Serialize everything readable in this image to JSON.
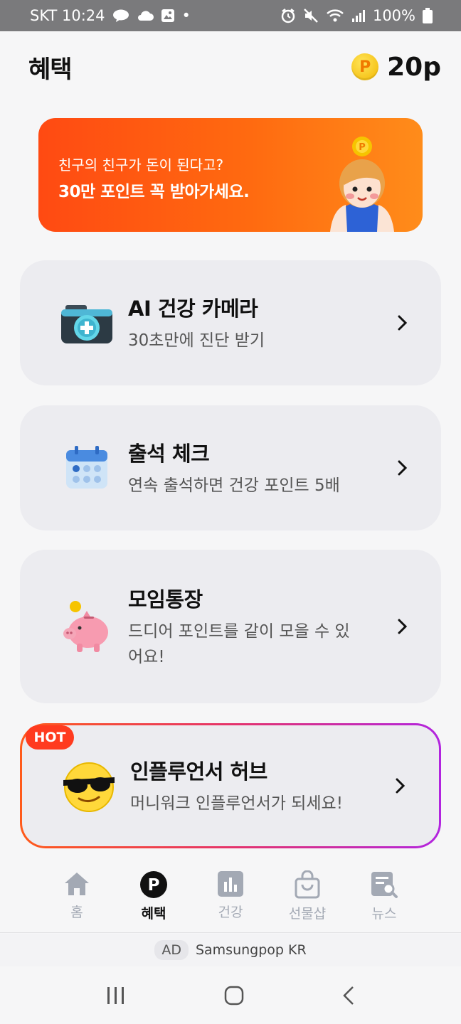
{
  "status_bar": {
    "carrier_time": "SKT 10:24",
    "dot": "•",
    "battery": "100%"
  },
  "header": {
    "title": "혜택",
    "coin_letter": "P",
    "points": "20p"
  },
  "banner": {
    "subtitle": "친구의 친구가 돈이 된다고?",
    "headline": "30만 포인트 꼭 받아가세요."
  },
  "cards": [
    {
      "title": "AI 건강 카메라",
      "desc": "30초만에 진단 받기",
      "icon": "medical-camera-icon"
    },
    {
      "title": "출석 체크",
      "desc": "연속 출석하면 건강 포인트 5배",
      "icon": "calendar-icon"
    },
    {
      "title": "모임통장",
      "desc": "드디어 포인트를 같이 모을 수 있어요!",
      "icon": "piggy-bank-icon"
    },
    {
      "title": "인플루언서 허브",
      "desc": "머니워크 인플루언서가 되세요!",
      "icon": "sunglasses-emoji-icon",
      "badge": "HOT"
    }
  ],
  "bottom_nav": [
    {
      "label": "홈",
      "icon": "home-icon",
      "active": false
    },
    {
      "label": "혜택",
      "icon": "points-icon",
      "active": true
    },
    {
      "label": "건강",
      "icon": "chart-icon",
      "active": false
    },
    {
      "label": "선물샵",
      "icon": "shopping-bag-icon",
      "active": false
    },
    {
      "label": "뉴스",
      "icon": "news-icon",
      "active": false
    }
  ],
  "ad": {
    "tag": "AD",
    "text": "Samsungpop KR"
  },
  "colors": {
    "accent_orange": "#ff5a12",
    "hot_red": "#ff3b1f",
    "hot_border_end": "#b224e0",
    "coin_yellow": "#f2b600"
  }
}
